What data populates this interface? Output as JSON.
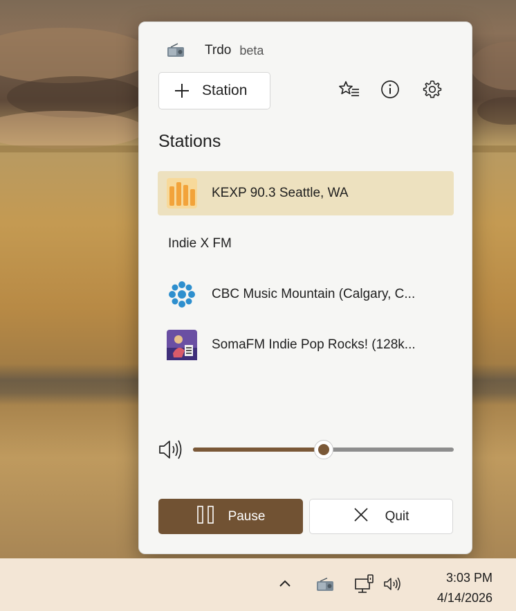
{
  "app": {
    "title": "Trdo",
    "badge": "beta",
    "icon": "radio-icon"
  },
  "toolbar": {
    "add_station_label": "Station",
    "favorites_icon": "favorites-list-icon",
    "info_icon": "info-icon",
    "settings_icon": "gear-icon"
  },
  "stations": {
    "title": "Stations",
    "items": [
      {
        "name": "KEXP 90.3 Seattle, WA",
        "logo": "kexp-logo",
        "selected": true
      },
      {
        "name": "Indie X FM",
        "logo": null,
        "selected": false
      },
      {
        "name": "CBC Music Mountain (Calgary, C...",
        "logo": "cbc-logo",
        "selected": false
      },
      {
        "name": "SomaFM Indie Pop Rocks! (128k...",
        "logo": "somafm-logo",
        "selected": false
      }
    ]
  },
  "volume": {
    "icon": "speaker-icon",
    "level_percent": 50
  },
  "controls": {
    "pause_label": "Pause",
    "quit_label": "Quit"
  },
  "taskbar": {
    "time": "3:03 PM",
    "date": "4/14/2026",
    "icons": [
      "chevron-up-icon",
      "radio-icon",
      "network-icon",
      "speaker-icon"
    ]
  },
  "colors": {
    "accent": "#715233",
    "selected_bg": "#ede1bf",
    "kexp_orange": "#f2a33a",
    "cbc_blue": "#2e8fce",
    "taskbar_bg": "#f3e6d6"
  }
}
